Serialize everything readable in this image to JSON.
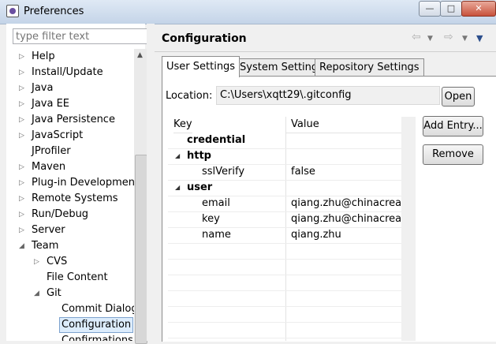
{
  "window": {
    "title": "Preferences",
    "minimize": "—",
    "maximize": "□",
    "close": "✕"
  },
  "filter": {
    "placeholder": "type filter text"
  },
  "tree": [
    {
      "label": "Help",
      "arrow": "▷",
      "level": 0
    },
    {
      "label": "Install/Update",
      "arrow": "▷",
      "level": 0
    },
    {
      "label": "Java",
      "arrow": "▷",
      "level": 0
    },
    {
      "label": "Java EE",
      "arrow": "▷",
      "level": 0
    },
    {
      "label": "Java Persistence",
      "arrow": "▷",
      "level": 0
    },
    {
      "label": "JavaScript",
      "arrow": "▷",
      "level": 0
    },
    {
      "label": "JProfiler",
      "arrow": "",
      "level": 0
    },
    {
      "label": "Maven",
      "arrow": "▷",
      "level": 0
    },
    {
      "label": "Plug-in Development",
      "arrow": "▷",
      "level": 0
    },
    {
      "label": "Remote Systems",
      "arrow": "▷",
      "level": 0
    },
    {
      "label": "Run/Debug",
      "arrow": "▷",
      "level": 0
    },
    {
      "label": "Server",
      "arrow": "▷",
      "level": 0
    },
    {
      "label": "Team",
      "arrow": "◢",
      "level": 0
    },
    {
      "label": "CVS",
      "arrow": "▷",
      "level": 1
    },
    {
      "label": "File Content",
      "arrow": "",
      "level": 1
    },
    {
      "label": "Git",
      "arrow": "◢",
      "level": 1
    },
    {
      "label": "Commit Dialog",
      "arrow": "",
      "level": 2
    },
    {
      "label": "Configuration",
      "arrow": "",
      "level": 2,
      "selected": true
    },
    {
      "label": "Confirmations",
      "arrow": "",
      "level": 2
    }
  ],
  "page": {
    "title": "Configuration"
  },
  "nav": {
    "back": "⇦",
    "forward": "⇨",
    "dropdown": "▼",
    "menu": "▼"
  },
  "tabs": [
    {
      "label": "User Settings",
      "active": true
    },
    {
      "label": "System Settings",
      "active": false
    },
    {
      "label": "Repository Settings",
      "active": false
    }
  ],
  "location": {
    "label": "Location:",
    "value": "C:\\Users\\xqtt29\\.gitconfig",
    "open_button": "Open"
  },
  "table": {
    "columns": [
      "Key",
      "Value"
    ],
    "rows": [
      {
        "key": "credential",
        "value": "",
        "bold": true,
        "level": 0,
        "expander": ""
      },
      {
        "key": "http",
        "value": "",
        "bold": true,
        "level": 0,
        "expander": "◢"
      },
      {
        "key": "sslVerify",
        "value": "false",
        "bold": false,
        "level": 1,
        "expander": ""
      },
      {
        "key": "user",
        "value": "",
        "bold": true,
        "level": 0,
        "expander": "◢"
      },
      {
        "key": "email",
        "value": "qiang.zhu@chinacreator.co",
        "bold": false,
        "level": 1,
        "expander": ""
      },
      {
        "key": "key",
        "value": "qiang.zhu@chinacreator.co",
        "bold": false,
        "level": 1,
        "expander": ""
      },
      {
        "key": "name",
        "value": "qiang.zhu",
        "bold": false,
        "level": 1,
        "expander": ""
      }
    ]
  },
  "actions": {
    "add_entry": "Add Entry...",
    "remove": "Remove"
  }
}
